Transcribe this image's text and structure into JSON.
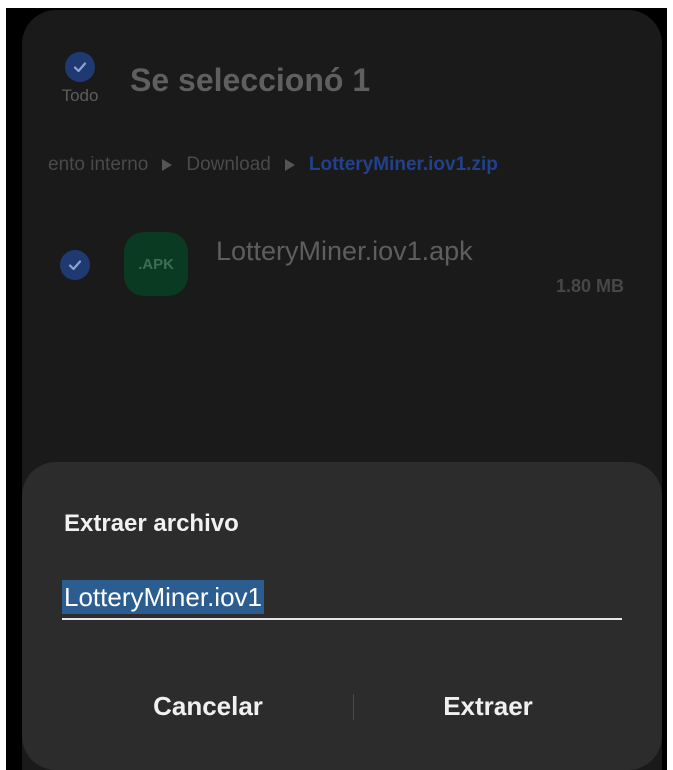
{
  "header": {
    "select_all_label": "Todo",
    "title": "Se seleccionó 1"
  },
  "breadcrumb": {
    "items": [
      "ento interno",
      "Download",
      "LotteryMiner.iov1.zip"
    ]
  },
  "file": {
    "icon_label": ".APK",
    "name": "LotteryMiner.iov1.apk",
    "size": "1.80 MB",
    "icon": "apk-file-icon"
  },
  "dialog": {
    "title": "Extraer archivo",
    "input_value": "LotteryMiner.iov1",
    "cancel_label": "Cancelar",
    "extract_label": "Extraer"
  },
  "colors": {
    "accent": "#1f3a73",
    "selection": "#2b5d91",
    "dialog_bg": "#2c2c2c",
    "screen_bg": "#1a1a1a",
    "apk_green": "#0b3a22"
  }
}
